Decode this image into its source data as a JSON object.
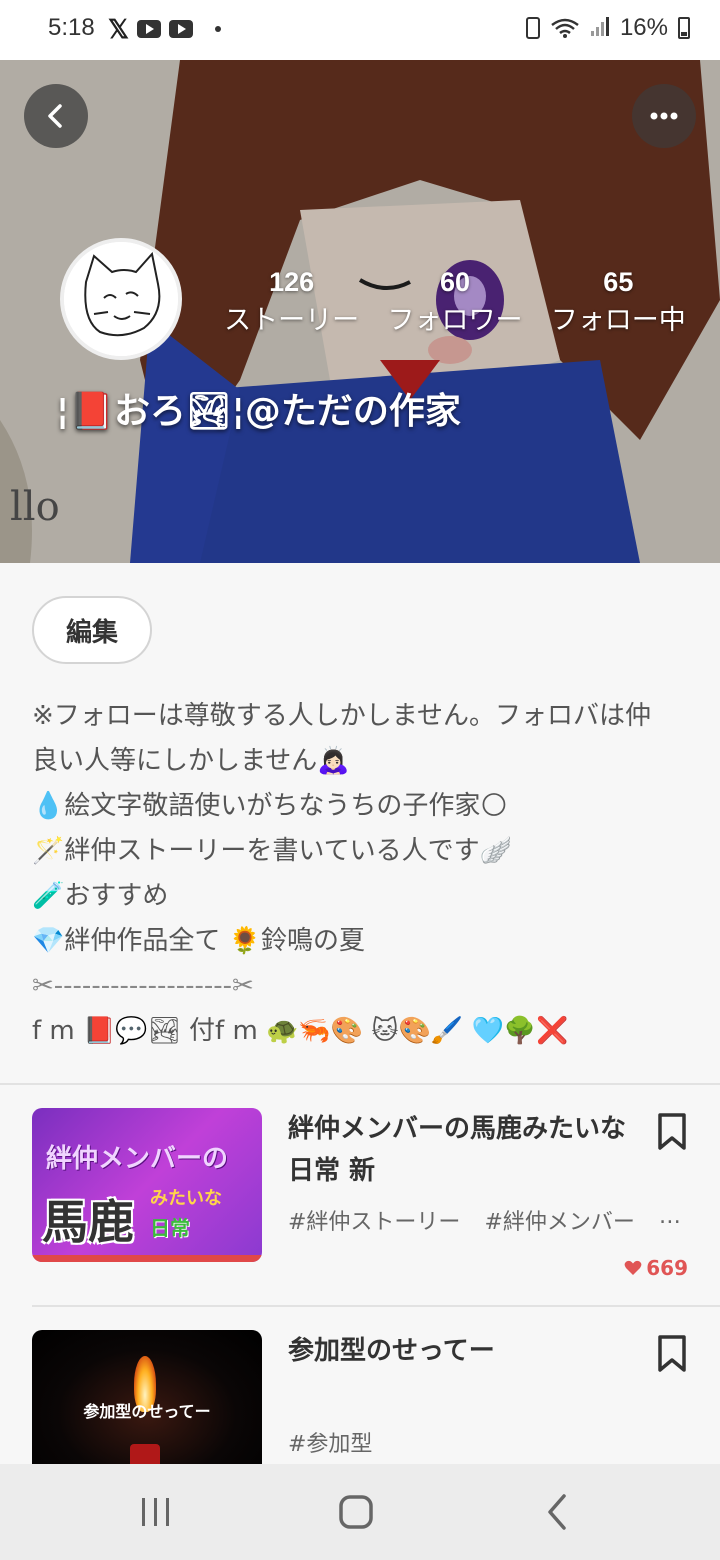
{
  "status_bar": {
    "time": "5:18",
    "battery_percent": "16%",
    "icons_left": [
      "x-icon",
      "youtube-icon",
      "youtube-icon",
      "dot-icon"
    ],
    "icons_right": [
      "battery-saver-icon",
      "wifi-icon",
      "signal-icon",
      "battery-icon"
    ]
  },
  "profile": {
    "display_name": "¦📕おろ🏞¦@ただの作家",
    "stats": [
      {
        "count": "126",
        "label": "ストーリー"
      },
      {
        "count": "60",
        "label": "フォロワー"
      },
      {
        "count": "65",
        "label": "フォロー中"
      }
    ],
    "edit_label": "編集",
    "bio": [
      "※フォローは尊敬する人しかしません。フォロバは仲",
      "良い人等にしかしません🙇🏻‍♀️",
      "💧絵文字敬語使いがちなうちの子作家🌕",
      "🪄絆仲ストーリーを書いている人です🪽",
      "🧪おすすめ",
      "💎絆仲作品全て 🌻鈴鳴の夏",
      "✂-------------------✂",
      "f m 📕💬🏞 付f m 🐢🦐🎨 🐱🎨🖌️ 🩵🌳❌"
    ]
  },
  "stories": [
    {
      "title": "絆仲メンバーの馬鹿みたいな日常 新",
      "tags": [
        "#絆仲ストーリー",
        "#絆仲メンバー",
        "…"
      ],
      "likes": "669",
      "thumb": {
        "top": "絆仲メンバーの",
        "big": "馬鹿",
        "side1": "みたいな",
        "side2": "日常"
      }
    },
    {
      "title": "参加型のせってー",
      "tags": [
        "#参加型"
      ],
      "likes": "",
      "thumb": {
        "text": "参加型のせってー"
      }
    }
  ],
  "colors": {
    "accent_like": "#e05555",
    "background": "#f7f7f7"
  }
}
